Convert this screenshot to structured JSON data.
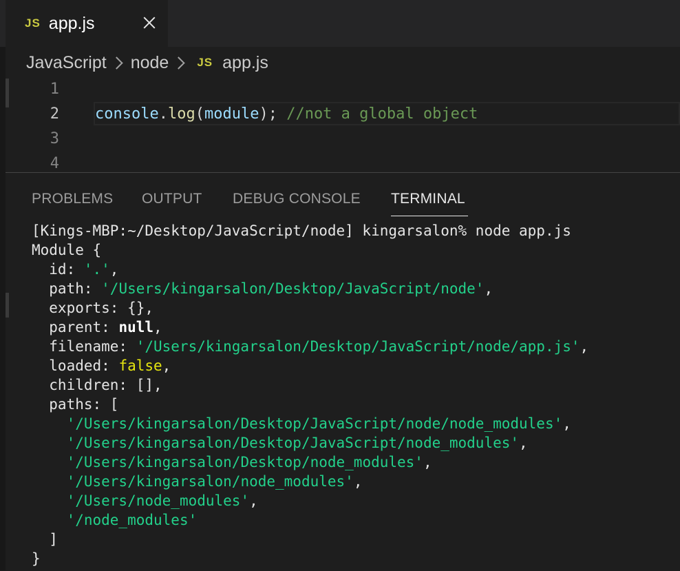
{
  "tab": {
    "icon": "JS",
    "label": "app.js"
  },
  "breadcrumb": {
    "items": [
      "JavaScript",
      "node"
    ],
    "file_icon": "JS",
    "file": "app.js"
  },
  "editor": {
    "line_numbers": [
      "1",
      "2",
      "3",
      "4"
    ],
    "line2": {
      "obj": "console",
      "dot": ".",
      "fn": "log",
      "open": "(",
      "arg": "module",
      "close": ");",
      "comment": "//not a global object"
    }
  },
  "panel": {
    "tabs": [
      "PROBLEMS",
      "OUTPUT",
      "DEBUG CONSOLE",
      "TERMINAL"
    ],
    "active_tab": "TERMINAL"
  },
  "terminal": {
    "prompt": "[Kings-MBP:~/Desktop/JavaScript/node] kingarsalon% node app.js",
    "module_open": "Module {",
    "id_key": "  id: ",
    "id_val": "'.'",
    "path_key": "  path: ",
    "path_val": "'/Users/kingarsalon/Desktop/JavaScript/node'",
    "exports": "  exports: {},",
    "parent_key": "  parent: ",
    "parent_val": "null",
    "filename_key": "  filename: ",
    "filename_val": "'/Users/kingarsalon/Desktop/JavaScript/node/app.js'",
    "loaded_key": "  loaded: ",
    "loaded_val": "false",
    "children": "  children: [],",
    "paths_open": "  paths: [",
    "paths": [
      "'/Users/kingarsalon/Desktop/JavaScript/node/node_modules'",
      "'/Users/kingarsalon/Desktop/JavaScript/node_modules'",
      "'/Users/kingarsalon/Desktop/node_modules'",
      "'/Users/kingarsalon/node_modules'",
      "'/Users/node_modules'",
      "'/node_modules'"
    ],
    "paths_close": "  ]",
    "module_close": "}"
  },
  "colors": {
    "background": "#1e1e1e",
    "string": "#23d18b",
    "boolean": "#e5e510",
    "comment": "#6a9955",
    "js_icon": "#cbcb41"
  }
}
